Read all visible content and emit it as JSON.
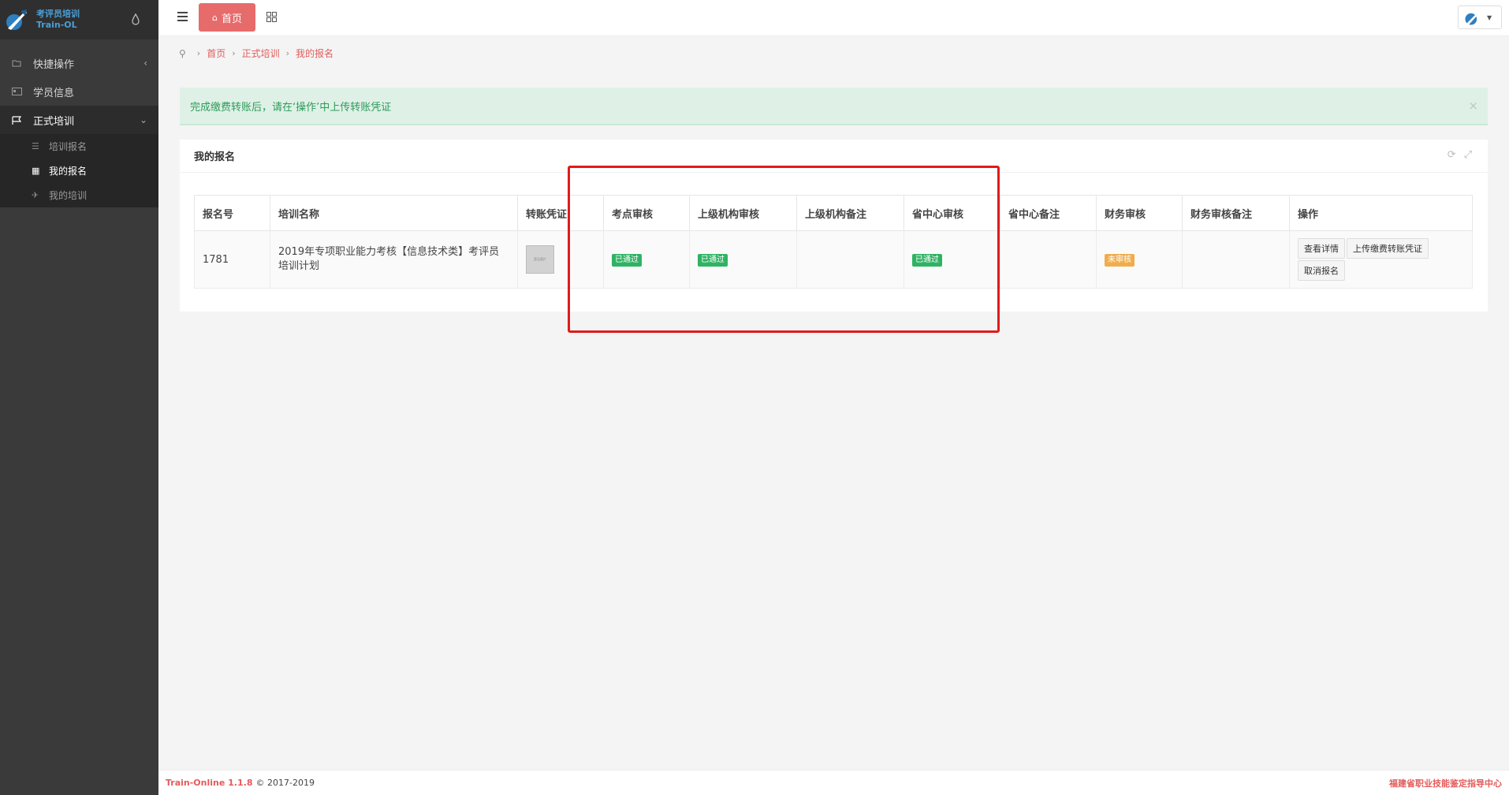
{
  "app": {
    "logo_line1": "考评员培训",
    "logo_line2": "Train-OL"
  },
  "sidebar": {
    "items": [
      {
        "label": "快捷操作",
        "icon": "folder-open-icon"
      },
      {
        "label": "学员信息",
        "icon": "id-card-icon"
      },
      {
        "label": "正式培训",
        "icon": "flag-icon"
      }
    ],
    "sub_items": [
      {
        "label": "培训报名",
        "icon": "list-icon"
      },
      {
        "label": "我的报名",
        "icon": "grid-icon"
      },
      {
        "label": "我的培训",
        "icon": "plane-icon"
      }
    ]
  },
  "topbar": {
    "home_label": "首页"
  },
  "breadcrumb": [
    "首页",
    "正式培训",
    "我的报名"
  ],
  "alert": {
    "text": "完成缴费转账后，请在‘操作’中上传转账凭证",
    "close": "×"
  },
  "panel": {
    "title": "我的报名"
  },
  "table": {
    "headers": [
      "报名号",
      "培训名称",
      "转账凭证",
      "考点审核",
      "上级机构审核",
      "上级机构备注",
      "省中心审核",
      "省中心备注",
      "财务审核",
      "财务审核备注",
      "操作"
    ],
    "rows": [
      {
        "id": "1781",
        "name": "2019年专项职业能力考核【信息技术类】考评员培训计划",
        "voucher_thumb_text": "暂无图片",
        "site_review": "已通过",
        "org_review": "已通过",
        "org_note": "",
        "center_review": "已通过",
        "center_note": "",
        "finance_review": "未审核",
        "finance_note": "",
        "actions": [
          "查看详情",
          "上传缴费转账凭证",
          "取消报名"
        ]
      }
    ]
  },
  "footer": {
    "version": "Train-Online 1.1.8",
    "copyright": "© 2017-2019",
    "org": "福建省职业技能鉴定指导中心"
  },
  "colors": {
    "accent": "#e76b6b",
    "sidebar_bg": "#3a3a3a",
    "success": "#2fb363",
    "warning": "#f0ad4e",
    "highlight": "#e01b1b"
  }
}
